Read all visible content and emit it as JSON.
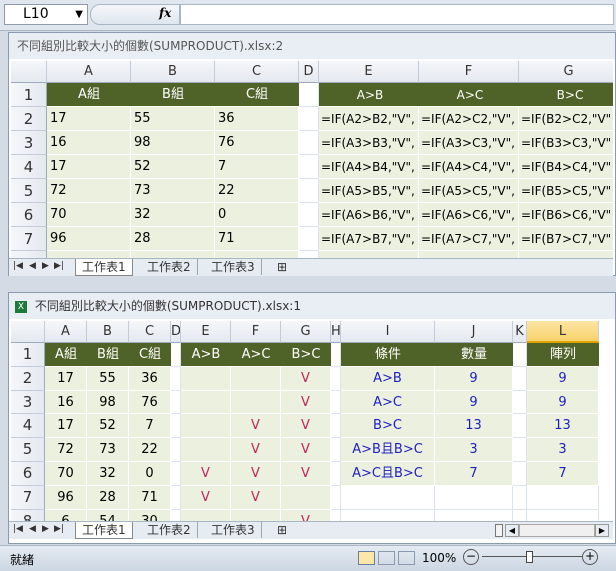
{
  "formula_bar": {
    "name_box": "L10",
    "fx_label": "fx",
    "formula": ""
  },
  "top_window": {
    "title": "不同組別比較大小的個數(SUMPRODUCT).xlsx:2",
    "columns": [
      "A",
      "B",
      "C",
      "D",
      "E",
      "F",
      "G"
    ],
    "rows": [
      "1",
      "2",
      "3",
      "4",
      "5",
      "6",
      "7"
    ],
    "headers": [
      "A組",
      "B組",
      "C組",
      "",
      "A>B",
      "A>C",
      "B>C"
    ],
    "data": [
      [
        "17",
        "55",
        "36",
        "",
        "=IF(A2>B2,\"V\",",
        "=IF(A2>C2,\"V\",",
        "=IF(B2>C2,\"V\""
      ],
      [
        "16",
        "98",
        "76",
        "",
        "=IF(A3>B3,\"V\",",
        "=IF(A3>C3,\"V\",",
        "=IF(B3>C3,\"V\""
      ],
      [
        "17",
        "52",
        "7",
        "",
        "=IF(A4>B4,\"V\",",
        "=IF(A4>C4,\"V\",",
        "=IF(B4>C4,\"V\""
      ],
      [
        "72",
        "73",
        "22",
        "",
        "=IF(A5>B5,\"V\",",
        "=IF(A5>C5,\"V\",",
        "=IF(B5>C5,\"V\""
      ],
      [
        "70",
        "32",
        "0",
        "",
        "=IF(A6>B6,\"V\",",
        "=IF(A6>C6,\"V\",",
        "=IF(B6>C6,\"V\""
      ],
      [
        "96",
        "28",
        "71",
        "",
        "=IF(A7>B7,\"V\",",
        "=IF(A7>C7,\"V\",",
        "=IF(B7>C7,\"V\""
      ]
    ],
    "tabs": [
      "工作表1",
      "工作表2",
      "工作表3"
    ]
  },
  "bottom_window": {
    "title": "不同組別比較大小的個數(SUMPRODUCT).xlsx:1",
    "columns": [
      "A",
      "B",
      "C",
      "D",
      "E",
      "F",
      "G",
      "H",
      "I",
      "J",
      "K",
      "L"
    ],
    "rows": [
      "1",
      "2",
      "3",
      "4",
      "5",
      "6",
      "7",
      "8"
    ],
    "headers": [
      "A組",
      "B組",
      "C組",
      "",
      "A>B",
      "A>C",
      "B>C",
      "",
      "條件",
      "數量",
      "",
      "陣列"
    ],
    "data": [
      [
        "17",
        "55",
        "36",
        "",
        "",
        "",
        "V",
        "",
        "A>B",
        "9",
        "",
        "9"
      ],
      [
        "16",
        "98",
        "76",
        "",
        "",
        "",
        "V",
        "",
        "A>C",
        "9",
        "",
        "9"
      ],
      [
        "17",
        "52",
        "7",
        "",
        "",
        "V",
        "V",
        "",
        "B>C",
        "13",
        "",
        "13"
      ],
      [
        "72",
        "73",
        "22",
        "",
        "",
        "V",
        "V",
        "",
        "A>B且B>C",
        "3",
        "",
        "3"
      ],
      [
        "70",
        "32",
        "0",
        "",
        "V",
        "V",
        "V",
        "",
        "A>C且B>C",
        "7",
        "",
        "7"
      ],
      [
        "96",
        "28",
        "71",
        "",
        "V",
        "V",
        "",
        "",
        "",
        "",
        "",
        ""
      ],
      [
        "6",
        "54",
        "30",
        "",
        "",
        "",
        "V",
        "",
        "",
        "",
        "",
        ""
      ]
    ],
    "tabs": [
      "工作表1",
      "工作表2",
      "工作表3"
    ]
  },
  "status_bar": {
    "ready": "就緒",
    "zoom": "100%",
    "zoom_out": "−",
    "zoom_in": "+"
  }
}
